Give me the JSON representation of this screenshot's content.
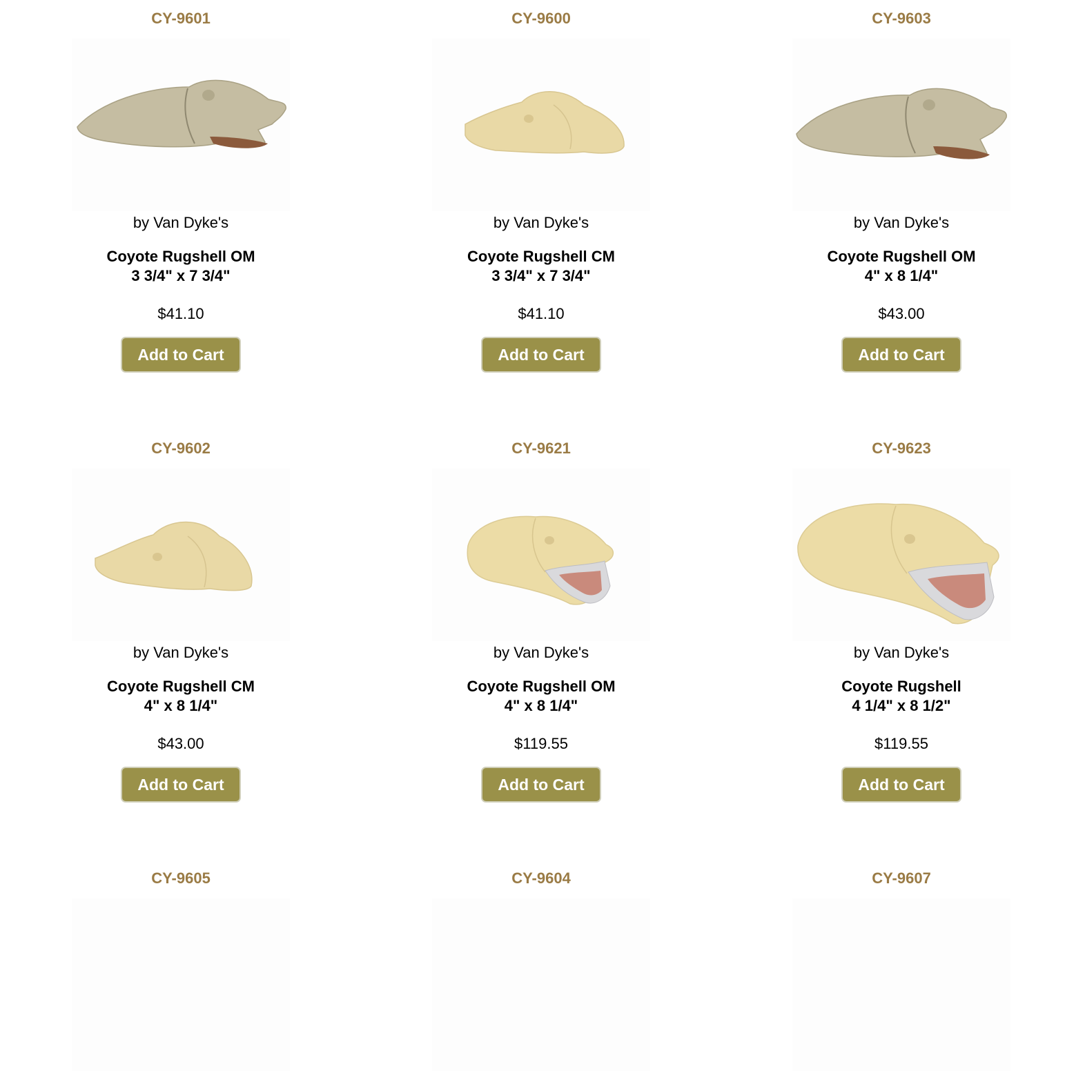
{
  "theme": {
    "sku_color": "#9a7b45",
    "button_color": "#9a9149"
  },
  "products": [
    {
      "sku": "CY-9601",
      "brand": "by Van Dyke's",
      "name": "Coyote Rugshell OM",
      "size": "3 3/4\" x 7 3/4\"",
      "price": "$41.10",
      "button": "Add to Cart",
      "image": "coyote-head-open-mouth-gray"
    },
    {
      "sku": "CY-9600",
      "brand": "by Van Dyke's",
      "name": "Coyote Rugshell CM",
      "size": "3 3/4\" x 7 3/4\"",
      "price": "$41.10",
      "button": "Add to Cart",
      "image": "coyote-head-closed-mouth-cream"
    },
    {
      "sku": "CY-9603",
      "brand": "by Van Dyke's",
      "name": "Coyote Rugshell OM",
      "size": "4\" x 8 1/4\"",
      "price": "$43.00",
      "button": "Add to Cart",
      "image": "coyote-head-open-mouth-gray"
    },
    {
      "sku": "CY-9602",
      "brand": "by Van Dyke's",
      "name": "Coyote Rugshell CM",
      "size": "4\" x 8 1/4\"",
      "price": "$43.00",
      "button": "Add to Cart",
      "image": "coyote-head-closed-mouth-cream"
    },
    {
      "sku": "CY-9621",
      "brand": "by Van Dyke's",
      "name": "Coyote Rugshell OM",
      "size": "4\" x 8 1/4\"",
      "price": "$119.55",
      "button": "Add to Cart",
      "image": "coyote-head-open-mouth-jaw-set"
    },
    {
      "sku": "CY-9623",
      "brand": "by Van Dyke's",
      "name": "Coyote Rugshell",
      "size": "4 1/4\" x 8 1/2\"",
      "price": "$119.55",
      "button": "Add to Cart",
      "image": "coyote-head-open-mouth-jaw-set"
    },
    {
      "sku": "CY-9605",
      "image": "product-image"
    },
    {
      "sku": "CY-9604",
      "image": "product-image"
    },
    {
      "sku": "CY-9607",
      "image": "product-image"
    }
  ]
}
